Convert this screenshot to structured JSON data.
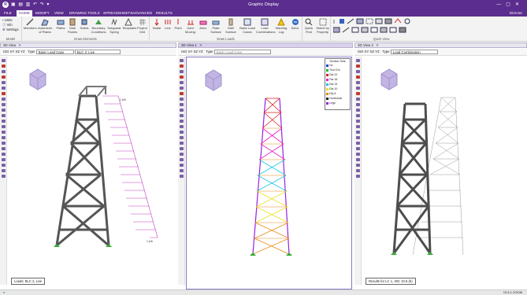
{
  "window": {
    "title": "Graphic Display",
    "logo": "R"
  },
  "menu": {
    "tabs": [
      "FILE",
      "HOME",
      "MODIFY",
      "VIEW",
      "DRAWING TOOLS",
      "SPREADSHEETS",
      "ADVANCED",
      "RESULTS"
    ],
    "active": "HOME",
    "user": "Director"
  },
  "ribbon": {
    "model_items": [
      "Units",
      "Info",
      "Settings"
    ],
    "model_label": "Model",
    "draw_buttons": [
      "Members",
      "Automesh of Plates",
      "Plates",
      "Wall Panels",
      "Solids",
      "Boundary Conditions",
      "Subgrade Spring",
      "Templates",
      "Project Grid"
    ],
    "draw_label": "Draw Elements",
    "load_buttons": [
      "Nodal",
      "Line",
      "Point",
      "Joint Moving",
      "Area",
      "Plate Surface",
      "Wall Surface",
      "Basic Load Cases",
      "Load Combinations",
      "Warning Log",
      "Solve"
    ],
    "load_label": "Draw Loads",
    "find_buttons": [
      "Quick Find",
      "Select by Property"
    ],
    "quick_view_label": "Quick View"
  },
  "views": [
    {
      "tab": "3D View",
      "type_label": "Type",
      "type_value": "Basic Load Case",
      "case_value": "BLC 2: Live",
      "status": "Loads: BLC 2, Live"
    },
    {
      "tab": "3D View 1",
      "type_label": "Type",
      "type_value": "Basic Load Case",
      "case_value": "",
      "status": ""
    },
    {
      "tab": "3D View 2",
      "type_label": "Type",
      "type_value": "Load Combination",
      "case_value": "",
      "status": "Results for LC 1, 40C 10.5 (b)"
    }
  ],
  "view_toggles": [
    "ISO",
    "XY",
    "XZ",
    "YZ"
  ],
  "legend": {
    "title": "Section Sets",
    "items": [
      {
        "label": "Hz",
        "color": "#1f3fd0"
      },
      {
        "label": "Thor Ext",
        "color": "#19b34a"
      },
      {
        "label": "Dia 22",
        "color": "#d81f1f"
      },
      {
        "label": "Dia 18",
        "color": "#e51fd0"
      },
      {
        "label": "Dia 14",
        "color": "#18c6e8"
      },
      {
        "label": "Dia 10",
        "color": "#e8e020"
      },
      {
        "label": "Dia 8",
        "color": "#e88a18"
      },
      {
        "label": "Horizontal",
        "color": "#1f1f1f"
      },
      {
        "label": "Legs",
        "color": "#9b1fe0"
      }
    ]
  },
  "load_labels": [
    "1 k/ft",
    "1 k/ft"
  ],
  "bottom": {
    "left": "",
    "right": "10.5.1 ZOOM"
  }
}
